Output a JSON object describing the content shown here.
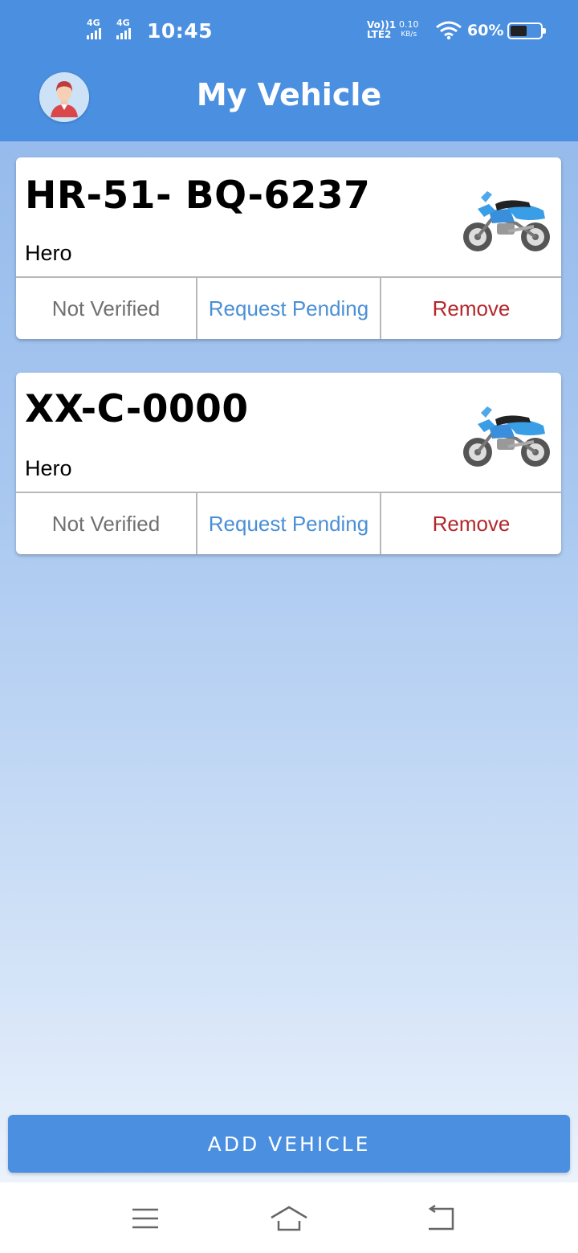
{
  "status_bar": {
    "signal1": "4G",
    "signal2": "4G",
    "time": "10:45",
    "volte_top": "Vo))1",
    "volte_bottom": "LTE2",
    "net_speed": "0.10",
    "net_unit": "KB/s",
    "battery_pct": "60%",
    "battery_level": 0.6
  },
  "header": {
    "title": "My Vehicle",
    "avatar_icon": "user-avatar-icon"
  },
  "vehicles": [
    {
      "plate": "HR-51- BQ-6237",
      "make": "Hero",
      "icon": "motorcycle-icon",
      "status": "Not Verified",
      "request": "Request Pending",
      "remove": "Remove"
    },
    {
      "plate": "XX-C-0000",
      "make": "Hero",
      "icon": "motorcycle-icon",
      "status": "Not Verified",
      "request": "Request Pending",
      "remove": "Remove"
    }
  ],
  "add_button": "ADD VEHICLE",
  "colors": {
    "primary": "#4a8fe0",
    "remove": "#b3282d",
    "pending": "#4a8fd6",
    "not_verified": "#707070"
  },
  "nav": {
    "menu_icon": "menu-icon",
    "home_icon": "home-icon",
    "back_icon": "back-icon"
  }
}
